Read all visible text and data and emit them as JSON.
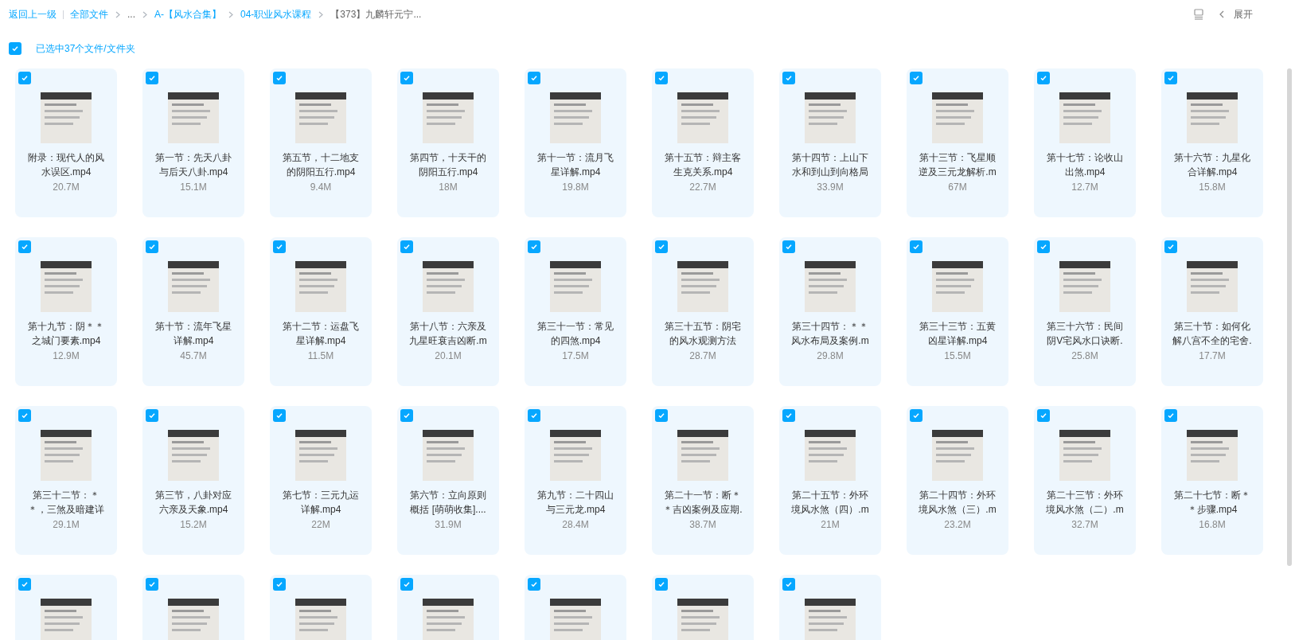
{
  "breadcrumb": {
    "back": "返回上一级",
    "items": [
      {
        "label": "全部文件",
        "link": true
      },
      {
        "label": "...",
        "link": false
      },
      {
        "label": "A-【风水合集】",
        "link": true
      },
      {
        "label": "04-职业风水课程",
        "link": true
      },
      {
        "label": "【373】九麟轩元宁...",
        "link": false
      }
    ]
  },
  "toolbar": {
    "expand": "展开"
  },
  "selection": {
    "checked": true,
    "label": "已选中37个文件/文件夹"
  },
  "files": [
    {
      "checked": true,
      "name": [
        "附录：现代人的风",
        "水误区.mp4"
      ],
      "size": "20.7M"
    },
    {
      "checked": true,
      "name": [
        "第一节：先天八卦",
        "与后天八卦.mp4"
      ],
      "size": "15.1M"
    },
    {
      "checked": true,
      "name": [
        "第五节，十二地支",
        "的阴阳五行.mp4"
      ],
      "size": "9.4M"
    },
    {
      "checked": true,
      "name": [
        "第四节，十天干的",
        "阴阳五行.mp4"
      ],
      "size": "18M"
    },
    {
      "checked": true,
      "name": [
        "第十一节：流月飞",
        "星详解.mp4"
      ],
      "size": "19.8M"
    },
    {
      "checked": true,
      "name": [
        "第十五节：辩主客",
        "生克关系.mp4"
      ],
      "size": "22.7M"
    },
    {
      "checked": true,
      "name": [
        "第十四节：上山下",
        "水和到山到向格局"
      ],
      "size": "33.9M"
    },
    {
      "checked": true,
      "name": [
        "第十三节：飞星顺",
        "逆及三元龙解析.m"
      ],
      "size": "67M"
    },
    {
      "checked": true,
      "name": [
        "第十七节：论收山",
        "出煞.mp4"
      ],
      "size": "12.7M"
    },
    {
      "checked": true,
      "name": [
        "第十六节：九星化",
        "合详解.mp4"
      ],
      "size": "15.8M"
    },
    {
      "checked": true,
      "name": [
        "第十九节：阴＊＊",
        "之城门要素.mp4"
      ],
      "size": "12.9M"
    },
    {
      "checked": true,
      "name": [
        "第十节：流年飞星",
        "详解.mp4"
      ],
      "size": "45.7M"
    },
    {
      "checked": true,
      "name": [
        "第十二节：运盘飞",
        "星详解.mp4"
      ],
      "size": "11.5M"
    },
    {
      "checked": true,
      "name": [
        "第十八节：六亲及",
        "九星旺衰吉凶断.m"
      ],
      "size": "20.1M"
    },
    {
      "checked": true,
      "name": [
        "第三十一节：常见",
        "的四煞.mp4"
      ],
      "size": "17.5M"
    },
    {
      "checked": true,
      "name": [
        "第三十五节：阴宅",
        "的风水观测方法"
      ],
      "size": "28.7M"
    },
    {
      "checked": true,
      "name": [
        "第三十四节：＊＊",
        "风水布局及案例.m"
      ],
      "size": "29.8M"
    },
    {
      "checked": true,
      "name": [
        "第三十三节：五黄",
        "凶星详解.mp4"
      ],
      "size": "15.5M"
    },
    {
      "checked": true,
      "name": [
        "第三十六节：民间",
        "阴V宅风水口诀断."
      ],
      "size": "25.8M"
    },
    {
      "checked": true,
      "name": [
        "第三十节：如何化",
        "解八宫不全的宅舍."
      ],
      "size": "17.7M"
    },
    {
      "checked": true,
      "name": [
        "第三十二节：＊",
        "＊，三煞及暗建详"
      ],
      "size": "29.1M"
    },
    {
      "checked": true,
      "name": [
        "第三节，八卦对应",
        "六亲及天象.mp4"
      ],
      "size": "15.2M"
    },
    {
      "checked": true,
      "name": [
        "第七节：三元九运",
        "详解.mp4"
      ],
      "size": "22M"
    },
    {
      "checked": true,
      "name": [
        "第六节：立向原则",
        "概括 [萌萌收集]...."
      ],
      "size": "31.9M"
    },
    {
      "checked": true,
      "name": [
        "第九节：二十四山",
        "与三元龙.mp4"
      ],
      "size": "28.4M"
    },
    {
      "checked": true,
      "name": [
        "第二十一节：断＊",
        "＊吉凶案例及应期."
      ],
      "size": "38.7M"
    },
    {
      "checked": true,
      "name": [
        "第二十五节：外环",
        "境风水煞（四）.m"
      ],
      "size": "21M"
    },
    {
      "checked": true,
      "name": [
        "第二十四节：外环",
        "境风水煞（三）.m"
      ],
      "size": "23.2M"
    },
    {
      "checked": true,
      "name": [
        "第二十三节：外环",
        "境风水煞（二）.m"
      ],
      "size": "32.7M"
    },
    {
      "checked": true,
      "name": [
        "第二十七节：断＊",
        "＊步骤.mp4"
      ],
      "size": "16.8M"
    },
    {
      "checked": true
    },
    {
      "checked": true
    },
    {
      "checked": true
    },
    {
      "checked": true
    },
    {
      "checked": true
    },
    {
      "checked": true
    },
    {
      "checked": true
    }
  ]
}
